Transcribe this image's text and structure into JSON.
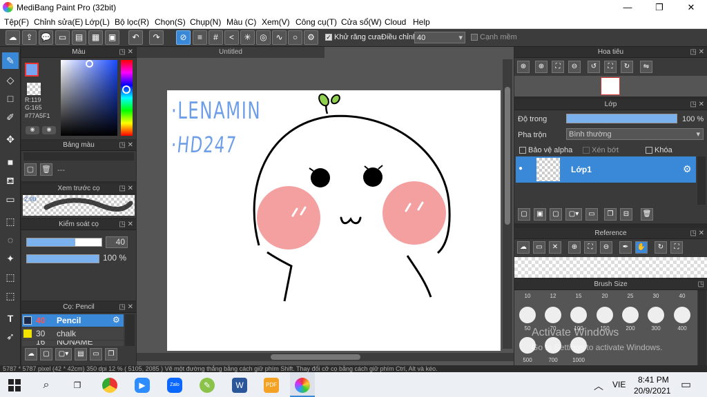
{
  "app_title": "MediBang Paint Pro (32bit)",
  "window_controls": {
    "minimize": "—",
    "maximize": "❐",
    "close": "✕"
  },
  "menu": [
    "Tệp(F)",
    "Chỉnh sửa(E)",
    "Lớp(L)",
    "Bộ lọc(R)",
    "Chọn(S)",
    "Chụp(N)",
    "Màu (C)",
    "Xem(V)",
    "Công cụ(T)",
    "Cửa sổ(W)",
    "Cloud",
    "Help"
  ],
  "toolbar": {
    "antialias_label": "Khử răng cưa",
    "adjust_label": "Điều chỉnh",
    "adjust_value": "40",
    "smooth_label": "Cạnh mềm"
  },
  "color_panel": {
    "title": "Màu",
    "r": "R:119",
    "g": "G:165",
    "hex": "#77A5F1",
    "fg_color": "#77A5F1"
  },
  "palette_panel": {
    "title": "Bảng màu",
    "value": "---"
  },
  "brush_preview": {
    "title": "Xem trước cọ",
    "size": "2.90"
  },
  "brush_control": {
    "title": "Kiểm soát cọ",
    "size": "40",
    "opacity": "100 %"
  },
  "brush_list": {
    "title": "Cọ: Pencil",
    "items": [
      {
        "size": "40",
        "name": "Pencil",
        "color": "#1a2a4a"
      },
      {
        "size": "30",
        "name": "chalk",
        "color": "#f2e200"
      },
      {
        "size": "16",
        "name": "NONAME",
        "color": "#333333"
      }
    ]
  },
  "canvas": {
    "tab": "Untitled",
    "text1": "·LENAMIN",
    "text2": "·HD247"
  },
  "navigator": {
    "title": "Hoa tiêu"
  },
  "layer_panel": {
    "title": "Lớp",
    "opacity_label": "Độ trong",
    "opacity_value": "100 %",
    "blend_label": "Pha trộn",
    "blend_value": "Bình thường",
    "protect_alpha": "Bảo vệ alpha",
    "clip": "Xén bớt",
    "lock": "Khóa",
    "layer_name": "Lớp1"
  },
  "reference": {
    "title": "Reference"
  },
  "brush_size": {
    "title": "Brush Size",
    "top_row": [
      "10",
      "12",
      "15",
      "20",
      "25",
      "30",
      "40"
    ],
    "mid_row": [
      "50",
      "70",
      "100",
      "150",
      "200",
      "300",
      "400"
    ],
    "bottom_row": [
      "500",
      "700",
      "1000"
    ]
  },
  "watermark": {
    "line1": "Activate Windows",
    "line2": "Go to Settings to activate Windows."
  },
  "status": "5787 * 5787 pixel   (42 * 42cm)   350 dpi   12 %   ( 5105, 2085 )   Vẽ một đường thẳng bằng cách giữ phím Shift. Thay đổi cỡ cọ bằng cách giữ phím Ctrl, Alt và kéo.",
  "taskbar": {
    "lang": "VIE",
    "time": "8:41 PM",
    "date": "20/9/2021"
  }
}
